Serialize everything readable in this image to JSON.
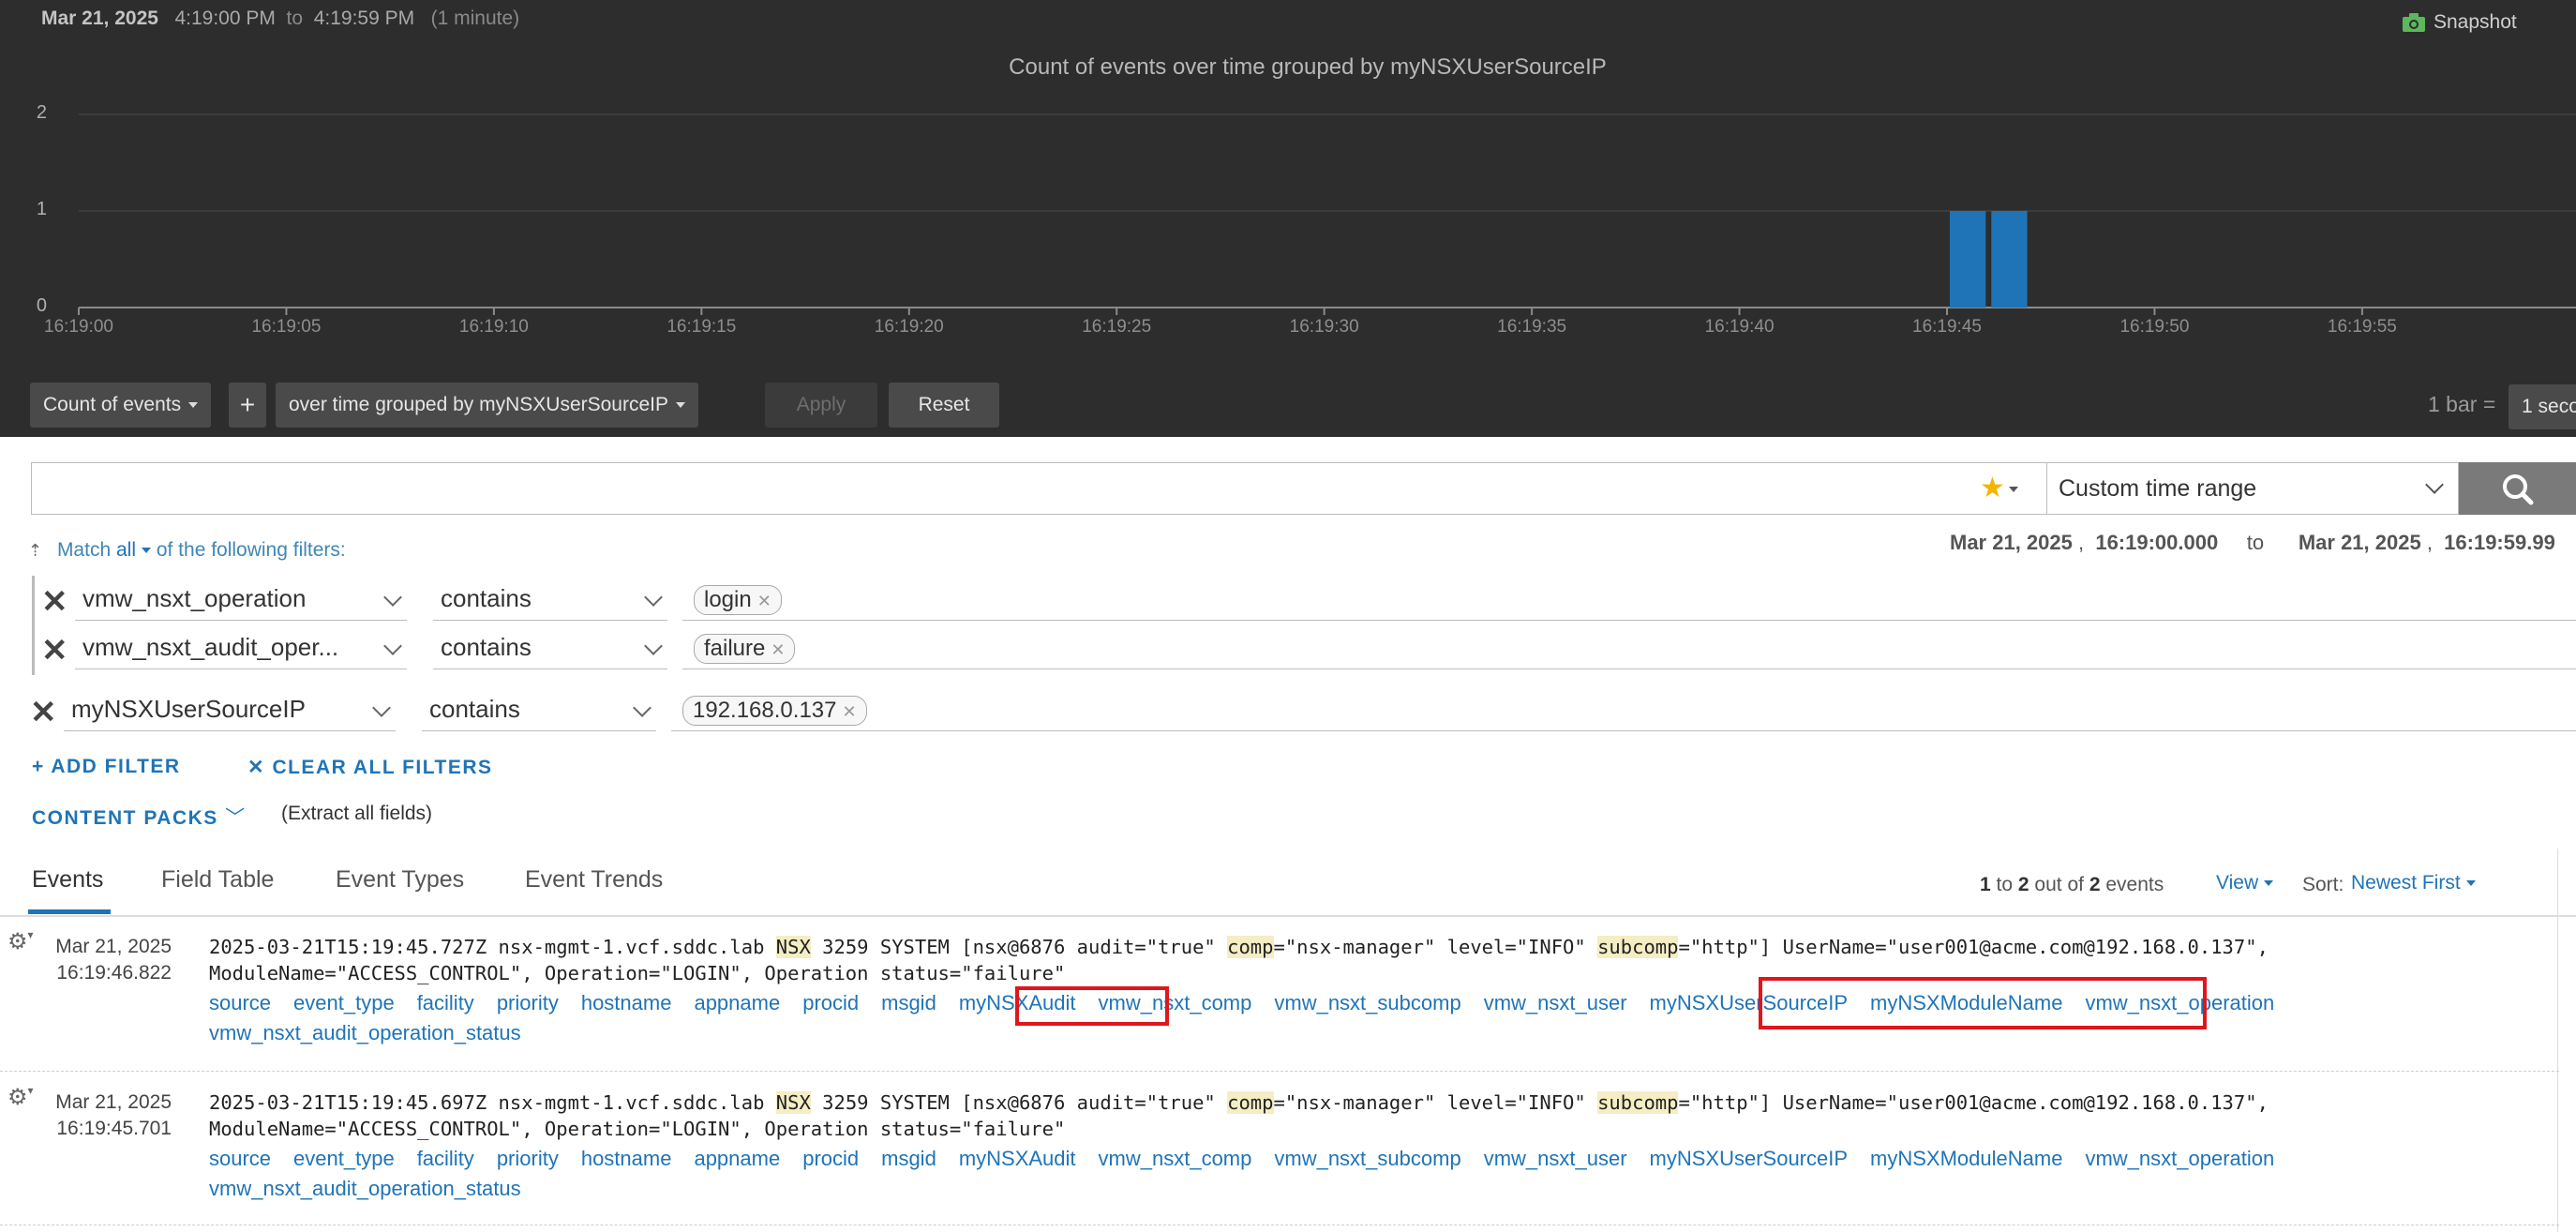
{
  "header": {
    "date": "Mar 21, 2025",
    "start_time": "4:19:00 PM",
    "to": "to",
    "end_time": "4:19:59 PM",
    "duration": "(1 minute)",
    "snapshot_label": "Snapshot"
  },
  "chart_data": {
    "type": "bar",
    "title": "Count of events over time grouped by myNSXUserSourceIP",
    "xlabel": "",
    "ylabel": "",
    "ylim": [
      0,
      2
    ],
    "y_ticks": [
      "0",
      "1",
      "2"
    ],
    "x_ticks": [
      "16:19:00",
      "16:19:05",
      "16:19:10",
      "16:19:15",
      "16:19:20",
      "16:19:25",
      "16:19:30",
      "16:19:35",
      "16:19:40",
      "16:19:45",
      "16:19:50",
      "16:19:55"
    ],
    "bar_x_seconds": [
      45,
      46
    ],
    "values": [
      1,
      1
    ],
    "bar_width_seconds": 1,
    "x_range_seconds": [
      0,
      60
    ],
    "grid": true,
    "color": "#1f74b7"
  },
  "chart_toolbar": {
    "count_label": "Count of events",
    "add_label": "+",
    "group_label": "over time grouped by myNSXUserSourceIP",
    "apply_label": "Apply",
    "reset_label": "Reset",
    "bar_label": "1 bar =",
    "bar_value": "1 seco"
  },
  "search": {
    "placeholder": "",
    "time_range": "Custom time range"
  },
  "filters_header": {
    "match_prefix": "Match",
    "match_value": "all",
    "match_suffix": "of the following filters:",
    "from_date": "Mar 21, 2025",
    "from_time": "16:19:00.000",
    "to": "to",
    "to_date": "Mar 21, 2025",
    "to_time": "16:19:59.99"
  },
  "filters": [
    {
      "field": "vmw_nsxt_operation",
      "operator": "contains",
      "value": "login"
    },
    {
      "field": "vmw_nsxt_audit_oper...",
      "operator": "contains",
      "value": "failure"
    },
    {
      "field": "myNSXUserSourceIP",
      "operator": "contains",
      "value": "192.168.0.137"
    }
  ],
  "actions": {
    "add_filter": "ADD FILTER",
    "clear_filters": "CLEAR ALL FILTERS",
    "content_packs": "CONTENT PACKS",
    "extract": "(Extract all fields)"
  },
  "tabs": [
    "Events",
    "Field Table",
    "Event Types",
    "Event Trends"
  ],
  "paging": {
    "from": "1",
    "to_word": "to",
    "to": "2",
    "out_of": "out of",
    "total": "2",
    "events_word": "events",
    "view_label": "View",
    "sort_label": "Sort:",
    "sort_value": "Newest First"
  },
  "events": [
    {
      "date": "Mar 21, 2025",
      "time": "16:19:46.822",
      "line1_parts": [
        "2025-03-21T15:19:45.727Z nsx-mgmt-1.vcf.sddc.lab ",
        "NSX",
        " 3259 SYSTEM [nsx@6876 audit=\"true\" ",
        "comp",
        "=\"nsx-manager\" level=\"INFO\" ",
        "subcomp",
        "=\"http\"] UserName=\"user001@acme.com@192.168.0.137\","
      ],
      "line2": "ModuleName=\"ACCESS_CONTROL\", Operation=\"LOGIN\", Operation status=\"failure\"",
      "fields": [
        "source",
        "event_type",
        "facility",
        "priority",
        "hostname",
        "appname",
        "procid",
        "msgid",
        "myNSXAudit",
        "vmw_nsxt_comp",
        "vmw_nsxt_subcomp",
        "vmw_nsxt_user",
        "myNSXUserSourceIP",
        "myNSXModuleName",
        "vmw_nsxt_operation",
        "vmw_nsxt_audit_operation_status"
      ]
    },
    {
      "date": "Mar 21, 2025",
      "time": "16:19:45.701",
      "line1_parts": [
        "2025-03-21T15:19:45.697Z nsx-mgmt-1.vcf.sddc.lab ",
        "NSX",
        " 3259 SYSTEM [nsx@6876 audit=\"true\" ",
        "comp",
        "=\"nsx-manager\" level=\"INFO\" ",
        "subcomp",
        "=\"http\"] UserName=\"user001@acme.com@192.168.0.137\","
      ],
      "line2": "ModuleName=\"ACCESS_CONTROL\", Operation=\"LOGIN\", Operation status=\"failure\"",
      "fields": [
        "source",
        "event_type",
        "facility",
        "priority",
        "hostname",
        "appname",
        "procid",
        "msgid",
        "myNSXAudit",
        "vmw_nsxt_comp",
        "vmw_nsxt_subcomp",
        "vmw_nsxt_user",
        "myNSXUserSourceIP",
        "myNSXModuleName",
        "vmw_nsxt_operation",
        "vmw_nsxt_audit_operation_status"
      ]
    }
  ]
}
